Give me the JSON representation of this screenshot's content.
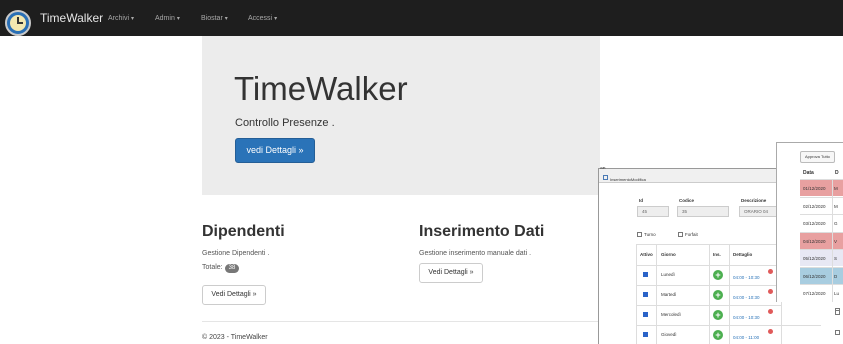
{
  "navbar": {
    "brand": "TimeWalker",
    "items": [
      "Archivi",
      "Admin",
      "Biostar",
      "Accessi"
    ]
  },
  "jumbotron": {
    "title": "TimeWalker",
    "subtitle": "Controllo Presenze .",
    "button": "vedi Dettagli »"
  },
  "dipendenti": {
    "title": "Dipendenti",
    "description": "Gestione Dipendenti .",
    "count_label": "Totale:",
    "count": "38",
    "button": "Vedi Dettagli »"
  },
  "inserimento": {
    "title": "Inserimento Dati",
    "description": "Gestione inserimento manuale dati .",
    "button": "Vedi Dettagli »"
  },
  "footer": "© 2023 - TimeWalker",
  "popup": {
    "top_label": "an",
    "title": "InserimentoModifica",
    "fields": {
      "id_label": "Id",
      "id_value": "45",
      "codice_label": "Codice",
      "codice_value": "35",
      "descrizione_label": "Descrizione",
      "descrizione_value": "ORARIO 04"
    },
    "turno_label": "Turno",
    "forfait_label": "Forfait",
    "table": {
      "headers": [
        "Attivo",
        "Giorno",
        "Ins.",
        "Dettaglio"
      ],
      "rows": [
        {
          "day": "Lunedì",
          "time": "04:00 - 10:30"
        },
        {
          "day": "Martedì",
          "time": "04:00 - 10:30"
        },
        {
          "day": "Mercoledì",
          "time": "04:00 - 10:30"
        },
        {
          "day": "Giovedì",
          "time": "04:00 - 11:00"
        }
      ]
    }
  },
  "popup2": {
    "approve_button": "Approva Tutto",
    "headers": [
      "Data",
      "D"
    ],
    "rows": [
      {
        "date": "01/12/2020",
        "abbr": "M",
        "color": "#e8a0a0"
      },
      {
        "date": "02/12/2020",
        "abbr": "M",
        "color": "#ffffff"
      },
      {
        "date": "03/12/2020",
        "abbr": "G",
        "color": "#ffffff"
      },
      {
        "date": "04/12/2020",
        "abbr": "V",
        "color": "#e8a0a0"
      },
      {
        "date": "05/12/2020",
        "abbr": "S",
        "color": "#e8e8f4"
      },
      {
        "date": "06/12/2020",
        "abbr": "D",
        "color": "#a8cde0"
      },
      {
        "date": "07/12/2020",
        "abbr": "Lu",
        "color": "#ffffff"
      }
    ]
  },
  "colors": {
    "navbar_bg": "#1e1e1e",
    "primary": "#2a73b8",
    "jumbotron_bg": "#ececec",
    "weekend_red": "#e8a0a0",
    "sunday_blue": "#a8cde0"
  }
}
